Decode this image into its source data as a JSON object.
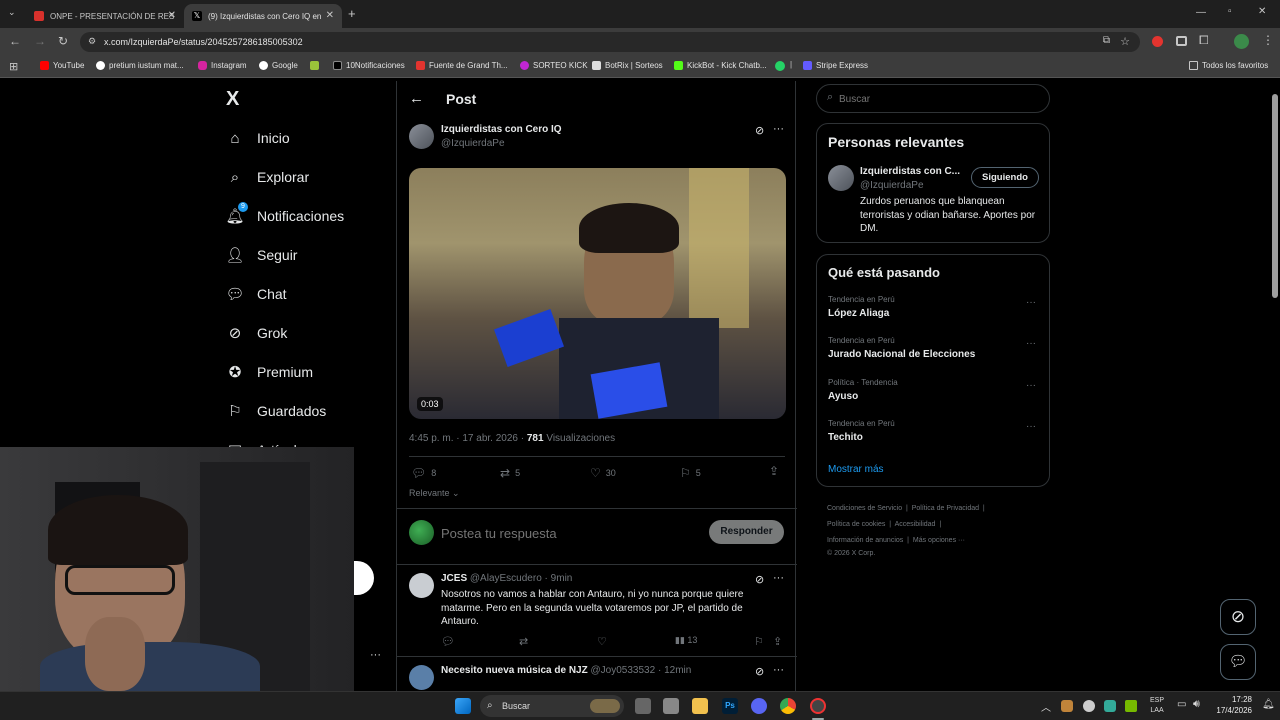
{
  "browser": {
    "tabs": [
      {
        "title": "ONPE - PRESENTACIÓN DE RES",
        "active": false
      },
      {
        "title": "(9) Izquierdistas con Cero IQ en",
        "active": true
      }
    ],
    "new_tab": "+",
    "url": "x.com/IzquierdaPe/status/2045257286185005302",
    "bookmarks": [
      "YouTube",
      "pretium iustum mat...",
      "Instagram",
      "Google",
      "10Notificaciones",
      "Fuente de Grand Th...",
      "SORTEO KICK",
      "BotRix | Sorteos",
      "KickBot - Kick Chatb...",
      "Stripe Express"
    ],
    "all_bookmarks": "Todos los favoritos"
  },
  "sidebar": {
    "logo": "X",
    "items": [
      {
        "label": "Inicio",
        "icon": "home-icon"
      },
      {
        "label": "Explorar",
        "icon": "search-icon"
      },
      {
        "label": "Notificaciones",
        "icon": "bell-icon",
        "badge": "9"
      },
      {
        "label": "Seguir",
        "icon": "follow-icon"
      },
      {
        "label": "Chat",
        "icon": "chat-icon"
      },
      {
        "label": "Grok",
        "icon": "grok-icon"
      },
      {
        "label": "Premium",
        "icon": "premium-icon"
      },
      {
        "label": "Guardados",
        "icon": "bookmark-icon"
      },
      {
        "label": "Artículos",
        "icon": "article-icon"
      }
    ],
    "more": "···"
  },
  "post": {
    "header": "Post",
    "author_name": "Izquierdistas con Cero IQ",
    "author_handle": "@IzquierdaPe",
    "video_time": "0:03",
    "timestamp": "4:45 p. m. · 17 abr. 2026 · ",
    "views_count": "781",
    "views_label": " Visualizaciones",
    "stats": {
      "replies": "8",
      "reposts": "5",
      "likes": "30",
      "bookmarks": "5"
    },
    "sort": "Relevante",
    "reply_placeholder": "Postea tu respuesta",
    "reply_button": "Responder"
  },
  "replies": [
    {
      "name": "JCES",
      "handle": "@AlayEscudero",
      "time": "9min",
      "text": "Nosotros no vamos a hablar con Antauro, ni yo nunca porque quiere matarme. Pero en la segunda vuelta votaremos por JP, el partido de Antauro.",
      "views": "13"
    },
    {
      "name": "Necesito nueva música de NJZ",
      "handle": "@Joy0533532",
      "time": "12min"
    }
  ],
  "right": {
    "search_placeholder": "Buscar",
    "relevant_title": "Personas relevantes",
    "relevant_name": "Izquierdistas con C...",
    "relevant_handle": "@IzquierdaPe",
    "following_button": "Siguiendo",
    "relevant_bio": "Zurdos peruanos que blanquean terroristas y odian bañarse. Aportes por DM.",
    "trends_title": "Qué está pasando",
    "trends": [
      {
        "category": "Tendencia en Perú",
        "name": "López Aliaga"
      },
      {
        "category": "Tendencia en Perú",
        "name": "Jurado Nacional de Elecciones"
      },
      {
        "category": "Política · Tendencia",
        "name": "Ayuso"
      },
      {
        "category": "Tendencia en Perú",
        "name": "Techito"
      }
    ],
    "show_more": "Mostrar más",
    "footer": [
      "Condiciones de Servicio",
      "Política de Privacidad",
      "Política de cookies",
      "Accesibilidad",
      "Información de anuncios",
      "Más opciones ···",
      "© 2026 X Corp."
    ]
  },
  "taskbar": {
    "search": "Buscar",
    "lang": "ESP",
    "layout": "LAA",
    "time": "17:28",
    "date": "17/4/2026"
  },
  "colors": {
    "accent": "#1d9bf0",
    "bg": "#000000",
    "border": "#2f3336",
    "muted": "#71767b"
  }
}
